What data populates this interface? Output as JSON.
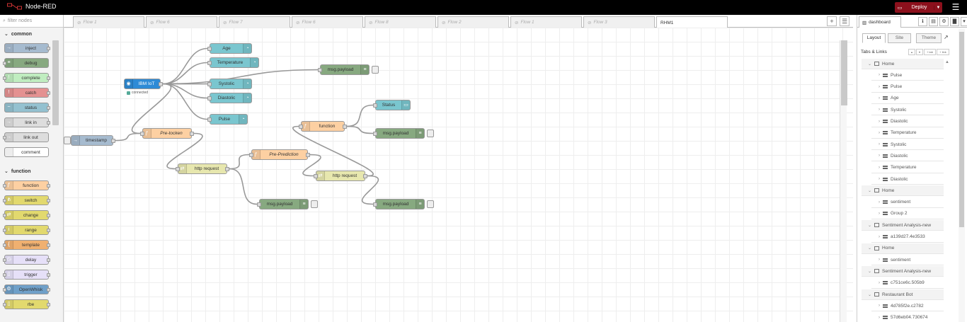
{
  "app": {
    "title": "Node-RED",
    "deploy_label": "Deploy"
  },
  "palette": {
    "filter_placeholder": "filter nodes",
    "categories": [
      {
        "name": "common",
        "nodes": [
          {
            "label": "inject",
            "color": "#a6bbcf"
          },
          {
            "label": "debug",
            "color": "#87a980"
          },
          {
            "label": "complete",
            "color": "#c0edc0"
          },
          {
            "label": "catch",
            "color": "#e49191"
          },
          {
            "label": "status",
            "color": "#94c1d0"
          },
          {
            "label": "link in",
            "color": "#dddddd"
          },
          {
            "label": "link out",
            "color": "#dddddd"
          },
          {
            "label": "comment",
            "color": "#ffffff"
          }
        ]
      },
      {
        "name": "function",
        "nodes": [
          {
            "label": "function",
            "color": "#fdd0a2"
          },
          {
            "label": "switch",
            "color": "#e2d96e"
          },
          {
            "label": "change",
            "color": "#e2d96e"
          },
          {
            "label": "range",
            "color": "#e2d96e"
          },
          {
            "label": "template",
            "color": "#f0b070"
          },
          {
            "label": "delay",
            "color": "#e6e0f8"
          },
          {
            "label": "trigger",
            "color": "#e6e0f8"
          },
          {
            "label": "OpenWhisk",
            "color": "#6fa0c9"
          },
          {
            "label": "rbe",
            "color": "#e2d96e"
          }
        ]
      }
    ]
  },
  "workspace_tabs": [
    "Flow 1",
    "Flow 6",
    "Flow 7",
    "Flow 6",
    "Flow 8",
    "Flow 2",
    "Flow 1",
    "Flow 3",
    "RHM1"
  ],
  "active_tab": "RHM1",
  "flow": {
    "nodes": {
      "ibm_iot": {
        "label": "IBM IoT",
        "status": "connected",
        "color": "#2e8bd6"
      },
      "age": {
        "label": "Age",
        "color": "#7ac6cf"
      },
      "temperature": {
        "label": "Temperature",
        "color": "#7ac6cf"
      },
      "systolic": {
        "label": "Systolic",
        "color": "#7ac6cf"
      },
      "diastolic": {
        "label": "Diastolic",
        "color": "#7ac6cf"
      },
      "pulse": {
        "label": "Pulse",
        "color": "#7ac6cf"
      },
      "msg_payload_1": {
        "label": "msg.payload",
        "color": "#87a980"
      },
      "timestamp": {
        "label": "timestamp",
        "color": "#a6bbcf"
      },
      "pre_token": {
        "label": "Pre-tocken",
        "color": "#fdd0a2"
      },
      "http_request_1": {
        "label": "http request",
        "color": "#e7e7ae"
      },
      "pre_prediction": {
        "label": "Pre-Prediction",
        "color": "#fdd0a2"
      },
      "msg_payload_2": {
        "label": "msg.payload",
        "color": "#87a980"
      },
      "function": {
        "label": "function",
        "color": "#fdd0a2"
      },
      "status": {
        "label": "Status",
        "color": "#7ac6cf"
      },
      "msg_payload_3": {
        "label": "msg.payload",
        "color": "#87a980"
      },
      "http_request_2": {
        "label": "http request",
        "color": "#e7e7ae"
      },
      "msg_payload_4": {
        "label": "msg.payload",
        "color": "#87a980"
      }
    },
    "wires": [
      [
        "ibm_iot",
        "age"
      ],
      [
        "ibm_iot",
        "temperature"
      ],
      [
        "ibm_iot",
        "systolic"
      ],
      [
        "ibm_iot",
        "diastolic"
      ],
      [
        "ibm_iot",
        "pulse"
      ],
      [
        "ibm_iot",
        "msg_payload_1"
      ],
      [
        "ibm_iot",
        "pre_token"
      ],
      [
        "timestamp",
        "pre_token"
      ],
      [
        "pre_token",
        "http_request_1"
      ],
      [
        "http_request_1",
        "pre_prediction"
      ],
      [
        "http_request_1",
        "msg_payload_2"
      ],
      [
        "pre_prediction",
        "http_request_2"
      ],
      [
        "http_request_2",
        "function"
      ],
      [
        "http_request_2",
        "msg_payload_4"
      ],
      [
        "function",
        "status"
      ],
      [
        "function",
        "msg_payload_3"
      ]
    ]
  },
  "sidebar": {
    "tab_label": "dashboard",
    "subtabs": [
      "Layout",
      "Site",
      "Theme"
    ],
    "active_subtab": "Layout",
    "section_title": "Tabs & Links",
    "mini_buttons": [
      "▴",
      "▾",
      "+ tab",
      "+ link"
    ],
    "tree": [
      {
        "type": "tab",
        "label": "Home"
      },
      {
        "type": "group",
        "label": "Pulse"
      },
      {
        "type": "group",
        "label": "Pulse"
      },
      {
        "type": "group",
        "label": "Age"
      },
      {
        "type": "group",
        "label": "Systolic"
      },
      {
        "type": "group",
        "label": "Diastolic"
      },
      {
        "type": "group",
        "label": "Temperature"
      },
      {
        "type": "group",
        "label": "Systolic"
      },
      {
        "type": "group",
        "label": "Diastolic"
      },
      {
        "type": "group",
        "label": "Temperature"
      },
      {
        "type": "group",
        "label": "Diastolic"
      },
      {
        "type": "tab",
        "label": "Home"
      },
      {
        "type": "group",
        "label": "sentiment"
      },
      {
        "type": "group",
        "label": "Group 2"
      },
      {
        "type": "tab",
        "label": "Sentiment Analysis-new"
      },
      {
        "type": "group",
        "label": "a139d27.4e3533"
      },
      {
        "type": "tab",
        "label": "Home"
      },
      {
        "type": "group",
        "label": "sentiment"
      },
      {
        "type": "tab",
        "label": "Sentiment Analysis-new"
      },
      {
        "type": "group",
        "label": "c751ce6c.505b9"
      },
      {
        "type": "tab",
        "label": "Restaurant Bot"
      },
      {
        "type": "group",
        "label": "4d785f2e.c2782"
      },
      {
        "type": "group",
        "label": "57d6eb04.730674"
      }
    ]
  }
}
